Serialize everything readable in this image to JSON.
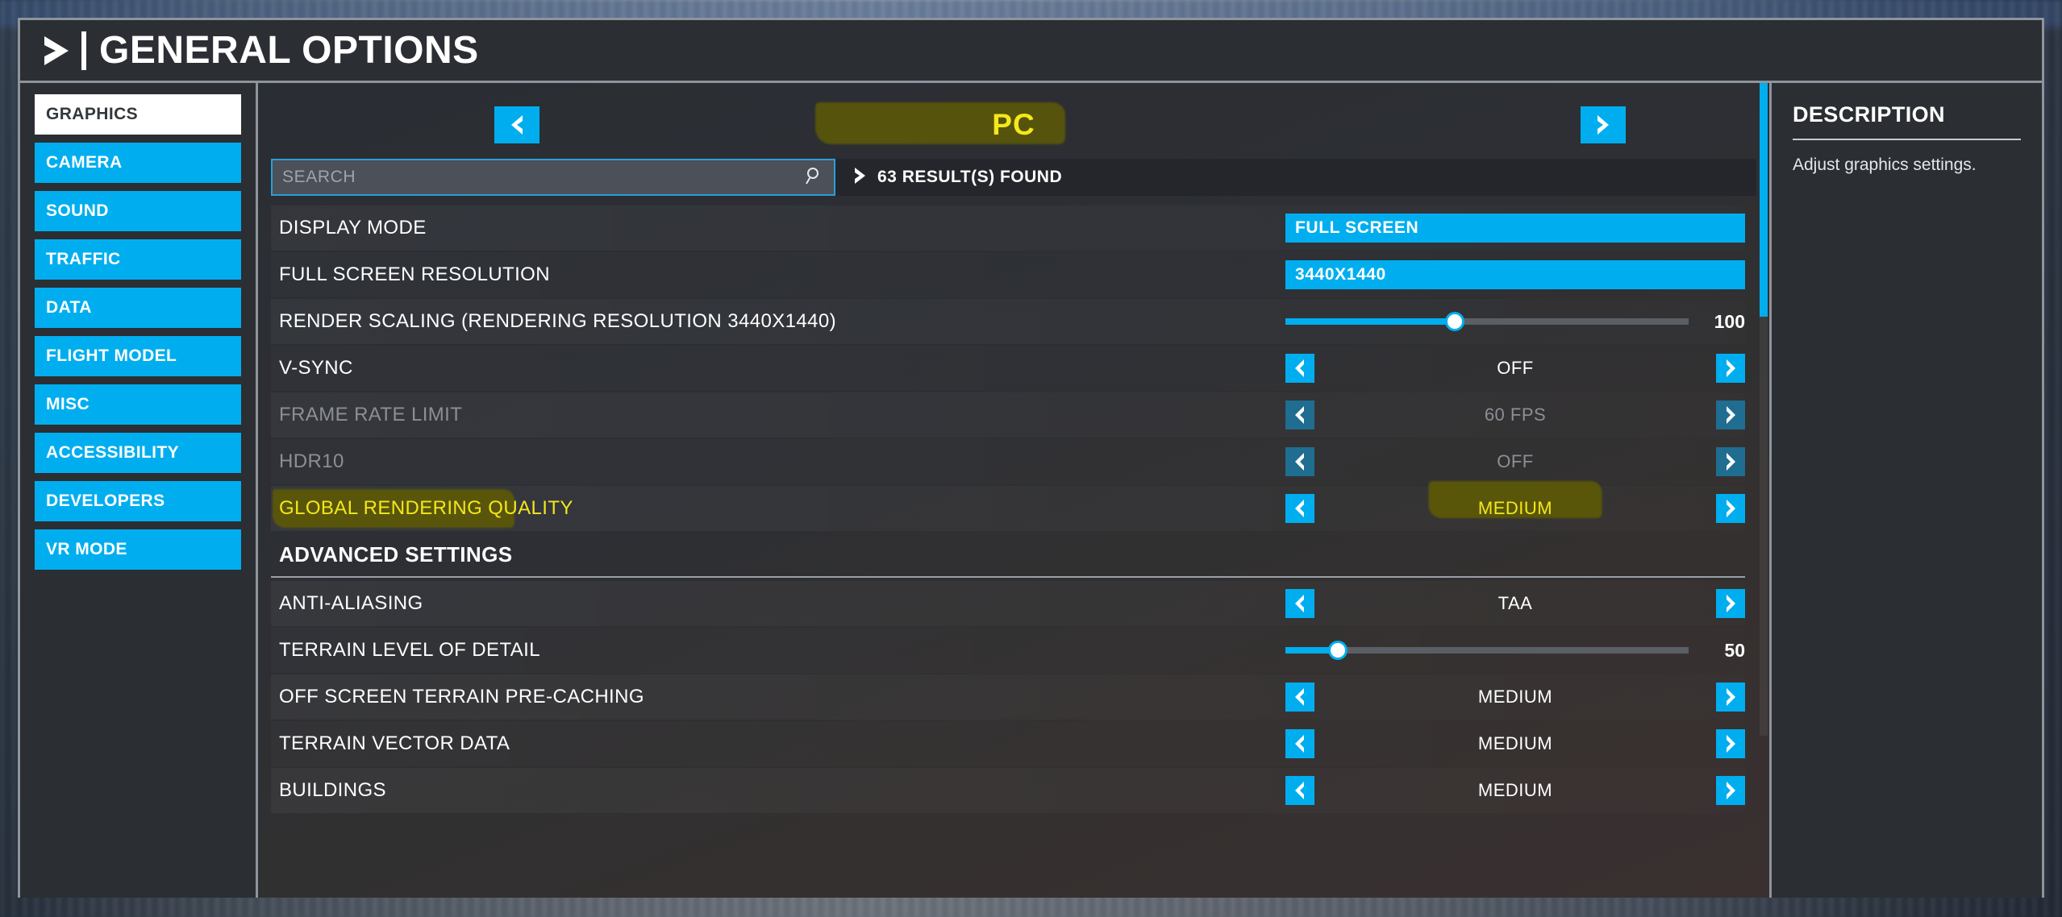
{
  "header": {
    "title": "GENERAL OPTIONS",
    "chevron_icon": "chevron-right-icon"
  },
  "sidebar": {
    "items": [
      {
        "label": "GRAPHICS",
        "active": true
      },
      {
        "label": "CAMERA",
        "active": false
      },
      {
        "label": "SOUND",
        "active": false
      },
      {
        "label": "TRAFFIC",
        "active": false
      },
      {
        "label": "DATA",
        "active": false
      },
      {
        "label": "FLIGHT MODEL",
        "active": false
      },
      {
        "label": "MISC",
        "active": false
      },
      {
        "label": "ACCESSIBILITY",
        "active": false
      },
      {
        "label": "DEVELOPERS",
        "active": false
      },
      {
        "label": "VR MODE",
        "active": false
      }
    ]
  },
  "platform": {
    "name": "PC",
    "prev_icon": "chevron-left-icon",
    "next_icon": "chevron-right-icon",
    "highlighted": true
  },
  "search": {
    "placeholder": "SEARCH",
    "value": "",
    "icon": "search-icon",
    "results_text": "63 RESULT(S) FOUND",
    "results_icon": "chevron-right-icon"
  },
  "settings": {
    "rows": [
      {
        "label": "DISPLAY MODE",
        "type": "pill",
        "value": "FULL SCREEN",
        "disabled": false,
        "highlight": false
      },
      {
        "label": "FULL SCREEN RESOLUTION",
        "type": "pill",
        "value": "3440X1440",
        "disabled": false,
        "highlight": false
      },
      {
        "label": "RENDER SCALING (RENDERING RESOLUTION 3440X1440)",
        "type": "slider",
        "value": "100",
        "percent": 42,
        "disabled": false,
        "highlight": false
      },
      {
        "label": "V-SYNC",
        "type": "select",
        "value": "OFF",
        "disabled": false,
        "highlight": false
      },
      {
        "label": "FRAME RATE LIMIT",
        "type": "select",
        "value": "60 FPS",
        "disabled": true,
        "highlight": false
      },
      {
        "label": "HDR10",
        "type": "select",
        "value": "OFF",
        "disabled": true,
        "highlight": false
      },
      {
        "label": "GLOBAL RENDERING QUALITY",
        "type": "select",
        "value": "MEDIUM",
        "disabled": false,
        "highlight": true
      },
      {
        "label": "ADVANCED SETTINGS",
        "type": "section",
        "value": "",
        "disabled": false,
        "highlight": false
      },
      {
        "label": "ANTI-ALIASING",
        "type": "select",
        "value": "TAA",
        "disabled": false,
        "highlight": false
      },
      {
        "label": "TERRAIN LEVEL OF DETAIL",
        "type": "slider",
        "value": "50",
        "percent": 13,
        "disabled": false,
        "highlight": false
      },
      {
        "label": "OFF SCREEN TERRAIN PRE-CACHING",
        "type": "select",
        "value": "MEDIUM",
        "disabled": false,
        "highlight": false
      },
      {
        "label": "TERRAIN VECTOR DATA",
        "type": "select",
        "value": "MEDIUM",
        "disabled": false,
        "highlight": false
      },
      {
        "label": "BUILDINGS",
        "type": "select",
        "value": "MEDIUM",
        "disabled": false,
        "highlight": false
      }
    ]
  },
  "description": {
    "title": "DESCRIPTION",
    "text": "Adjust graphics settings."
  },
  "colors": {
    "accent": "#00aeef",
    "highlight": "#f5e71a",
    "highlight_bg": "#5d5a06",
    "panel": "#2b2e33",
    "border": "#8d949c"
  }
}
